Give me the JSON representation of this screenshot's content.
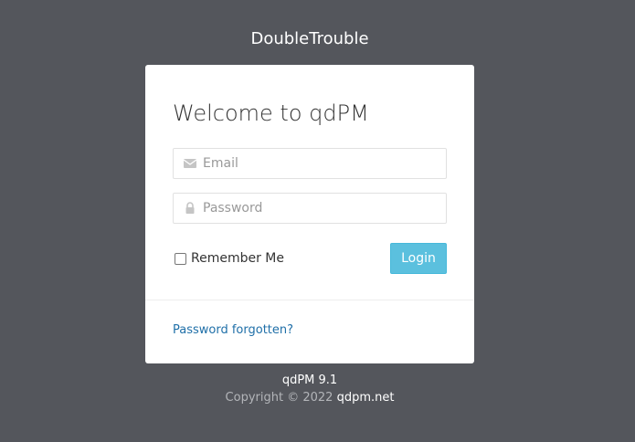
{
  "app": {
    "title": "DoubleTrouble"
  },
  "login": {
    "heading": "Welcome to qdPM",
    "email_placeholder": "Email",
    "password_placeholder": "Password",
    "remember_label": "Remember Me",
    "login_label": "Login",
    "forgot_label": "Password forgotten?",
    "icons": {
      "email": "envelope-icon",
      "password": "lock-icon"
    }
  },
  "footer": {
    "version": "qdPM 9.1",
    "copyright_text": "Copyright © 2022",
    "copyright_link": "qdpm.net"
  },
  "colors": {
    "background": "#54565c",
    "card": "#ffffff",
    "button": "#5bc0de",
    "link": "#1f6fa8"
  }
}
